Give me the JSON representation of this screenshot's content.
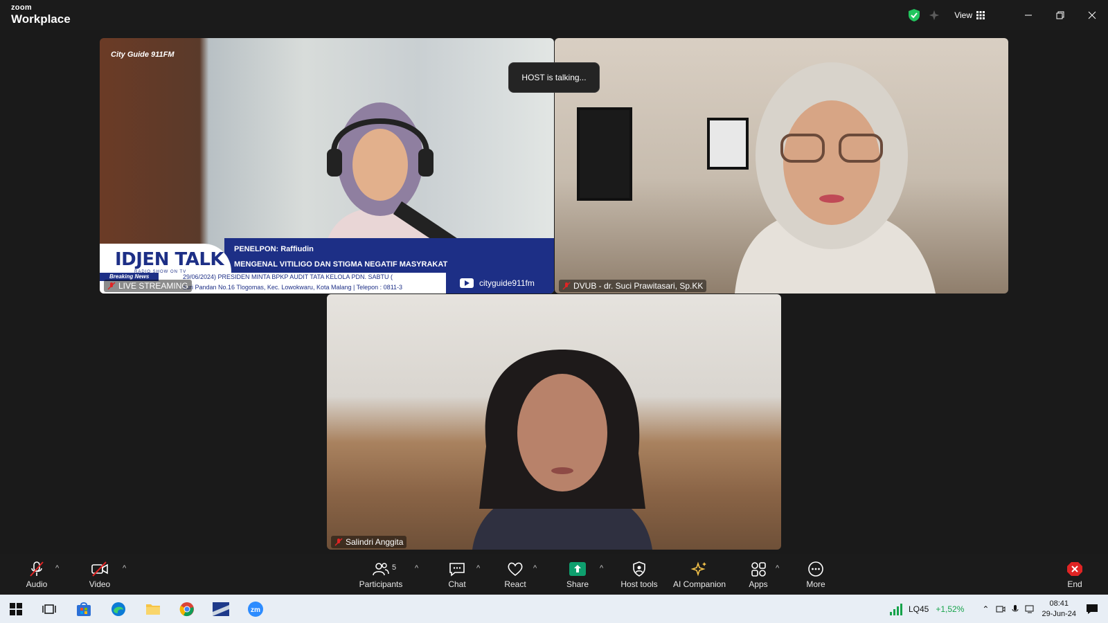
{
  "app": {
    "brand_top": "zoom",
    "brand_bottom": "Workplace",
    "view_label": "View"
  },
  "banner": {
    "talking": "HOST is talking..."
  },
  "tiles": [
    {
      "name": "LIVE STREAMING",
      "muted": true
    },
    {
      "name": "DVUB - dr. Suci Prawitasari, Sp.KK",
      "muted": true
    },
    {
      "name": "Salindri Anggita",
      "muted": true
    }
  ],
  "broadcast": {
    "station_logo": "City Guide 911FM",
    "show_title": "IDJEN TALK",
    "show_subtitle": "RADIO SHOW ON TV",
    "caller": "PENELPON: Raffiudin",
    "topic": "MENGENAL VITILIGO DAN STIGMA NEGATIF MASYRAKAT",
    "breaking_label": "Breaking News",
    "ticker_line1": "29/06/2024) PRESIDEN MINTA BPKP AUDIT TATA KELOLA PDN.     SABTU (",
    "ticker_line2": "duri Pandan No.16 Tlogomas, Kec. Lowokwaru, Kota Malang | Telepon : 0811-3",
    "youtube_handle": "cityguide911fm"
  },
  "toolbar": {
    "audio": "Audio",
    "video": "Video",
    "participants": "Participants",
    "participants_count": "5",
    "chat": "Chat",
    "react": "React",
    "share": "Share",
    "host_tools": "Host tools",
    "ai_companion": "AI Companion",
    "apps": "Apps",
    "more": "More",
    "end": "End"
  },
  "taskbar": {
    "stock_symbol": "LQ45",
    "stock_change": "+1,52%",
    "time": "08:41",
    "date": "29-Jun-24"
  },
  "colors": {
    "accent_green": "#22c55e",
    "end_red": "#e02424",
    "broadcast_blue": "#1d2f86",
    "share_green": "#0e9f6e"
  }
}
